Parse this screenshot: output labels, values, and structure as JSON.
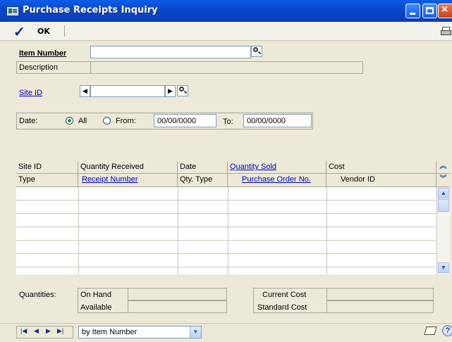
{
  "window": {
    "title": "Purchase Receipts Inquiry"
  },
  "toolbar": {
    "ok_label": "OK"
  },
  "fields": {
    "item_number_label": "Item Number",
    "item_number_value": "",
    "description_label": "Description",
    "site_id_label": "Site ID",
    "site_id_value": "",
    "date_label": "Date:",
    "all_label": "All",
    "from_label": "From:",
    "from_value": "00/00/0000",
    "to_label": "To:",
    "to_value": "00/00/0000",
    "date_selected": "All"
  },
  "grid": {
    "header_row1": [
      "Site ID",
      "Quantity Received",
      "Date",
      "Quantity Sold",
      "Cost"
    ],
    "header_row2": [
      "Type",
      "Receipt Number",
      "Qty. Type",
      "Purchase Order No.",
      "Vendor ID"
    ],
    "row_count_visible": 7
  },
  "quantities": {
    "section_label": "Quantities:",
    "on_hand_label": "On Hand",
    "available_label": "Available",
    "current_cost_label": "Current Cost",
    "standard_cost_label": "Standard Cost"
  },
  "statusbar": {
    "sort_value": "by Item Number"
  },
  "icons": {
    "ok": "checkmark-icon",
    "print": "printer-icon",
    "lookup": "magnifier-icon",
    "note": "note-icon",
    "help": "help-icon"
  }
}
